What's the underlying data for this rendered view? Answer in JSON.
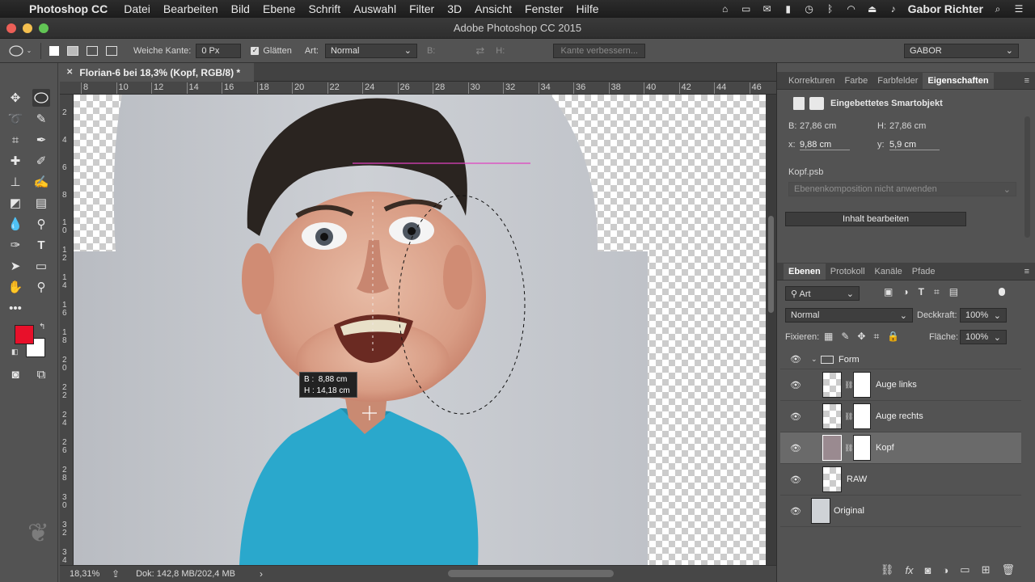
{
  "menubar": {
    "app_name": "Photoshop CC",
    "items": [
      "Datei",
      "Bearbeiten",
      "Bild",
      "Ebene",
      "Schrift",
      "Auswahl",
      "Filter",
      "3D",
      "Ansicht",
      "Fenster",
      "Hilfe"
    ],
    "user": "Gabor Richter"
  },
  "window": {
    "title": "Adobe Photoshop CC 2015"
  },
  "options": {
    "feather_label": "Weiche Kante:",
    "feather_value": "0 Px",
    "antialias_label": "Glätten",
    "style_label": "Art:",
    "style_value": "Normal",
    "width_label": "B:",
    "height_label": "H:",
    "refine_edge_button": "Kante verbessern...",
    "workspace": "GABOR"
  },
  "document": {
    "tab_title": "Florian-6 bei 18,3% (Kopf, RGB/8) *",
    "ruler_top_labels": [
      "8",
      "10",
      "12",
      "14",
      "16",
      "18",
      "20",
      "22",
      "24",
      "26",
      "28",
      "30",
      "32",
      "34",
      "36",
      "38",
      "40",
      "42",
      "44",
      "46"
    ],
    "ruler_left_labels": [
      "2",
      "4",
      "6",
      "8",
      "1\n0",
      "1\n2",
      "1\n4",
      "1\n6",
      "1\n8",
      "2\n0",
      "2\n2",
      "2\n4",
      "2\n6",
      "2\n8",
      "3\n0",
      "3\n2",
      "3\n4"
    ],
    "tooltip_width": "B :  8,88 cm",
    "tooltip_height": "H : 14,18 cm"
  },
  "status": {
    "zoom": "18,31%",
    "doc_info": "Dok: 142,8 MB/202,4 MB"
  },
  "properties_panel": {
    "tabs": [
      "Korrekturen",
      "Farbe",
      "Farbfelder",
      "Eigenschaften"
    ],
    "active_tab": "Eigenschaften",
    "object_type": "Eingebettetes Smartobjekt",
    "w_label": "B:",
    "w_value": "27,86 cm",
    "h_label": "H:",
    "h_value": "27,86 cm",
    "x_label": "x:",
    "x_value": "9,88 cm",
    "y_label": "y:",
    "y_value": "5,9 cm",
    "filename": "Kopf.psb",
    "comp_select": "Ebenenkomposition nicht anwenden",
    "edit_button": "Inhalt bearbeiten"
  },
  "layers_panel": {
    "tabs": [
      "Ebenen",
      "Protokoll",
      "Kanäle",
      "Pfade"
    ],
    "active_tab": "Ebenen",
    "filter_value": "Art",
    "blend_mode": "Normal",
    "opacity_label": "Deckkraft:",
    "opacity_value": "100%",
    "lock_label": "Fixieren:",
    "fill_label": "Fläche:",
    "fill_value": "100%",
    "layers": [
      {
        "name": "Form",
        "type": "group"
      },
      {
        "name": "Auge links",
        "type": "smart-mask"
      },
      {
        "name": "Auge rechts",
        "type": "smart-mask"
      },
      {
        "name": "Kopf",
        "type": "smart-mask",
        "selected": true
      },
      {
        "name": "RAW",
        "type": "smart"
      },
      {
        "name": "Original",
        "type": "smart"
      }
    ]
  },
  "colors": {
    "foreground": "#e8102a",
    "background": "#ffffff",
    "photo_bg": "#c4c6cc",
    "shirt": "#2aa8cc",
    "selection_guide": "#e040c0"
  }
}
